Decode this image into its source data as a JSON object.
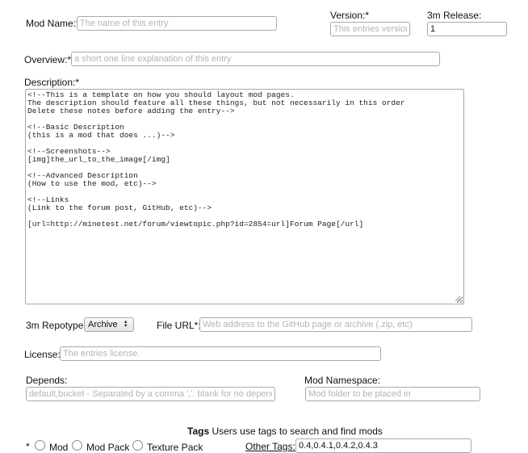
{
  "mod_name": {
    "label": "Mod Name:*",
    "placeholder": "The name of this entry"
  },
  "version": {
    "label": "Version:*",
    "placeholder": "This entries version"
  },
  "release": {
    "label": "3m Release:",
    "value": "1"
  },
  "overview": {
    "label": "Overview:*",
    "placeholder": "a short one line explanation of this entry"
  },
  "description": {
    "label": "Description:*",
    "value": "<!--This is a template on how you should layout mod pages.\nThe description should feature all these things, but not necessarily in this order\nDelete these notes before adding the entry-->\n\n<!--Basic Description\n(this is a mod that does ...)-->\n\n<!--Screenshots-->\n[img]the_url_to_the_image[/img]\n\n<!--Advanced Description\n(How to use the mod, etc)-->\n\n<!--Links\n(Link to the forum post, GitHub, etc)-->\n\n[url=http://minetest.net/forum/viewtopic.php?id=2854=url]Forum Page[/url]"
  },
  "repotype": {
    "label": "3m Repotype:",
    "selected": "Archive"
  },
  "file_url": {
    "label": "File URL*:",
    "placeholder": "Web address to the GitHub page or archive (.zip, etc)"
  },
  "license": {
    "label": "License:",
    "placeholder": "The entries license."
  },
  "depends": {
    "label": "Depends:",
    "placeholder": "default,bucket - Separated by a comma ','. blank for no dependencies"
  },
  "namespace": {
    "label": "Mod Namespace:",
    "placeholder": "Mod folder to be placed in"
  },
  "tags": {
    "title": "Tags",
    "hint": "Users use tags to search and find mods",
    "asterisk": "*",
    "options": [
      "Mod",
      "Mod Pack",
      "Texture Pack"
    ],
    "other_label": "Other Tags:",
    "other_value": "0.4,0.4.1,0.4.2,0.4.3"
  }
}
